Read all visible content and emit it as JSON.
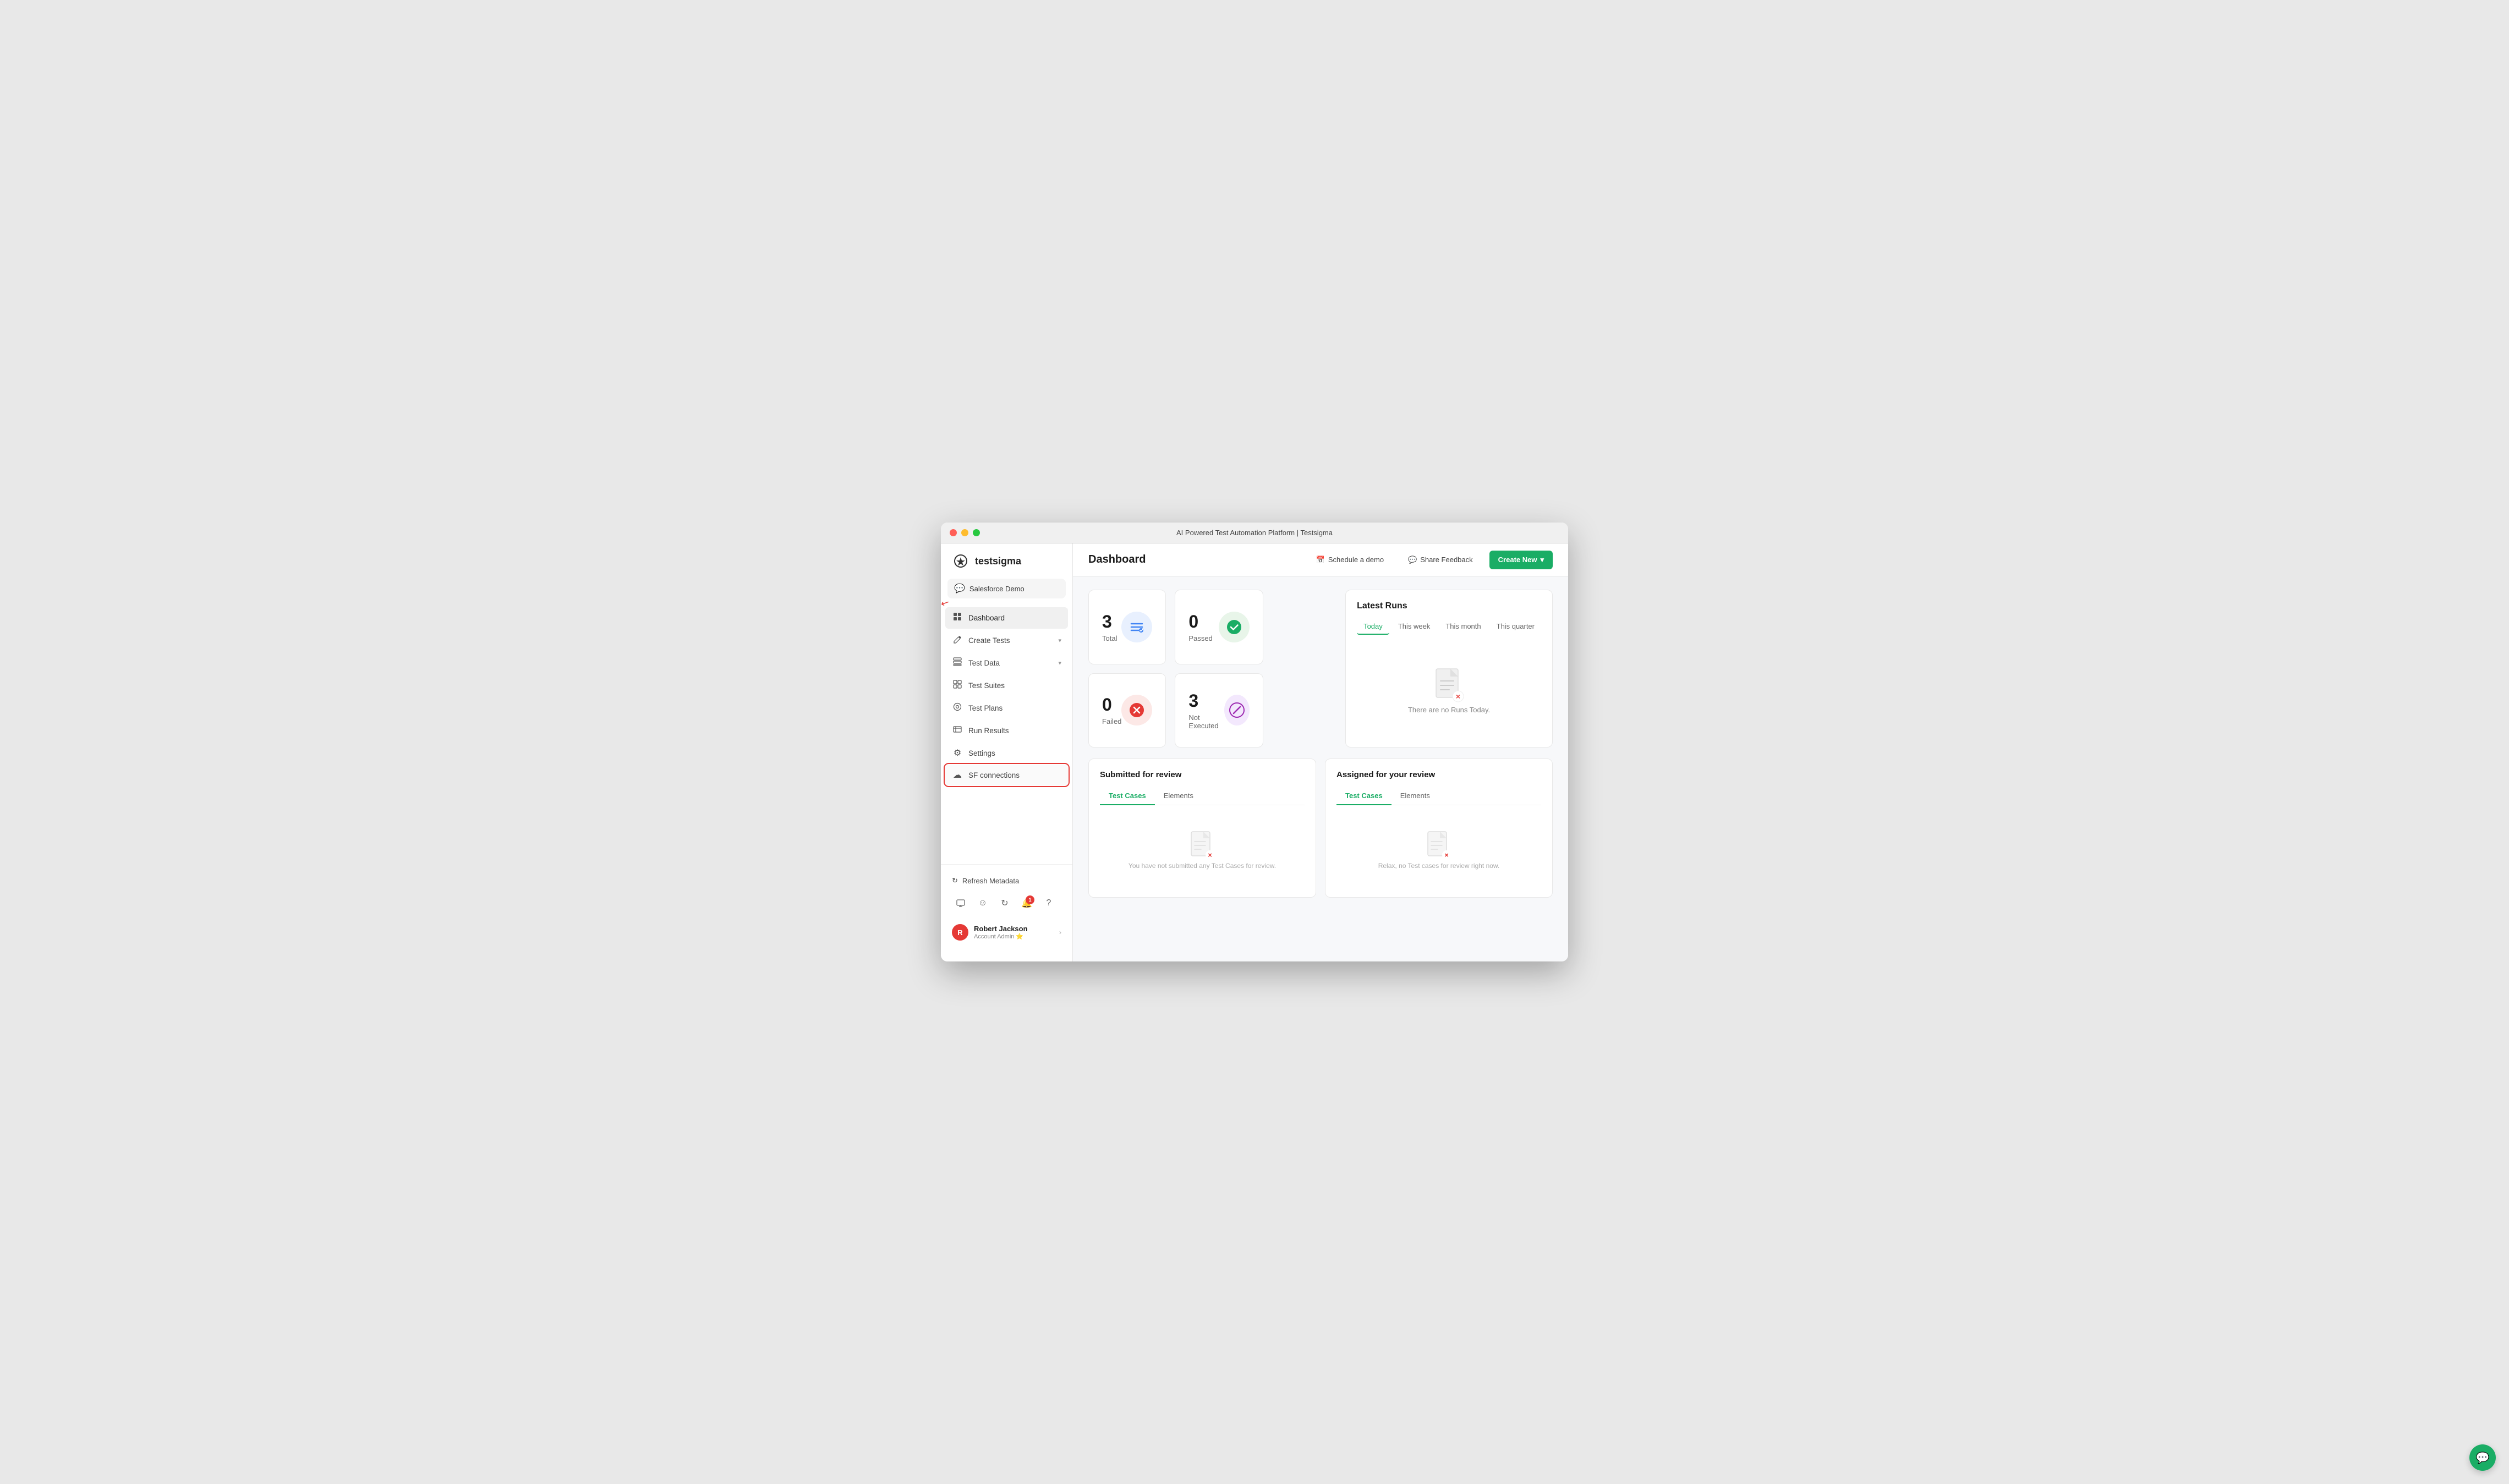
{
  "window": {
    "title": "AI Powered Test Automation Platform | Testsigma"
  },
  "sidebar": {
    "logo_text": "testsigma",
    "workspace": "Salesforce Demo",
    "nav_items": [
      {
        "id": "dashboard",
        "label": "Dashboard",
        "icon": "⊞",
        "active": true,
        "has_arrow": true
      },
      {
        "id": "create-tests",
        "label": "Create Tests",
        "icon": "✎",
        "has_chevron": true
      },
      {
        "id": "test-data",
        "label": "Test Data",
        "icon": "▦",
        "has_chevron": true
      },
      {
        "id": "test-suites",
        "label": "Test Suites",
        "icon": "⊞"
      },
      {
        "id": "test-plans",
        "label": "Test Plans",
        "icon": "⊙"
      },
      {
        "id": "run-results",
        "label": "Run Results",
        "icon": "▭"
      },
      {
        "id": "settings",
        "label": "Settings",
        "icon": "⚙"
      },
      {
        "id": "sf-connections",
        "label": "SF connections",
        "icon": "☁",
        "highlighted": true
      }
    ],
    "refresh_btn": "Refresh Metadata",
    "bottom_icons": [
      {
        "id": "screen-icon",
        "symbol": "⊞"
      },
      {
        "id": "feedback-icon",
        "symbol": "☺"
      },
      {
        "id": "sync-icon",
        "symbol": "↻"
      },
      {
        "id": "notification-icon",
        "symbol": "🔔",
        "badge": "1"
      },
      {
        "id": "help-icon",
        "symbol": "?"
      }
    ],
    "user": {
      "initial": "R",
      "name": "Robert Jackson",
      "role": "Account Admin",
      "role_emoji": "⭐"
    }
  },
  "topbar": {
    "page_title": "Dashboard",
    "schedule_demo_label": "Schedule a demo",
    "share_feedback_label": "Share Feedback",
    "create_new_label": "Create New"
  },
  "stats": {
    "total": {
      "number": "3",
      "label": "Total"
    },
    "passed": {
      "number": "0",
      "label": "Passed"
    },
    "failed": {
      "number": "0",
      "label": "Failed"
    },
    "not_executed": {
      "number": "3",
      "label": "Not Executed"
    }
  },
  "latest_runs": {
    "title": "Latest Runs",
    "tabs": [
      "Today",
      "This week",
      "This month",
      "This quarter"
    ],
    "active_tab": "Today",
    "empty_text": "There are no Runs Today."
  },
  "submitted_review": {
    "title": "Submitted for review",
    "tabs": [
      "Test Cases",
      "Elements"
    ],
    "active_tab": "Test Cases",
    "empty_text": "You have not submitted any Test Cases for review."
  },
  "assigned_review": {
    "title": "Assigned for your review",
    "tabs": [
      "Test Cases",
      "Elements"
    ],
    "active_tab": "Test Cases",
    "empty_text": "Relax, no Test cases for review right now."
  }
}
